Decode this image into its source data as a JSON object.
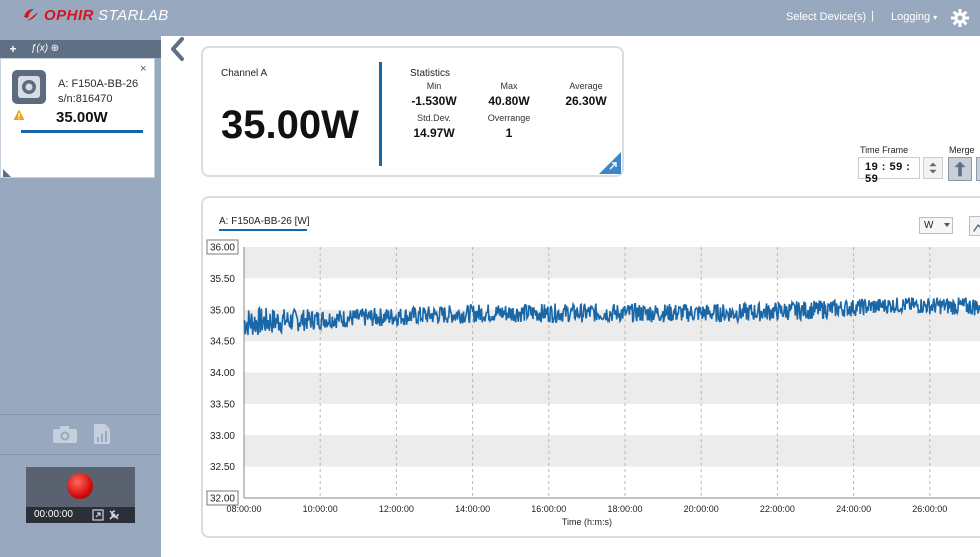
{
  "app": {
    "logo_brand": "OPHIR",
    "logo_product": "STARLAB",
    "select_devices_label": "Select Device(s)",
    "separator": "|",
    "logging_label": "Logging",
    "icons": {
      "gear": "gear-icon",
      "back": "chevron-left-icon"
    }
  },
  "sidebar": {
    "toolbar": {
      "add_label": "+",
      "math_label": "ƒ(x)"
    },
    "device": {
      "name": "A: F150A-BB-26",
      "serial": "s/n:816470",
      "value": "35.00W",
      "close_label": "×",
      "accent_color": "#1a67a8",
      "warning_color": "#e9a21a"
    },
    "recorder": {
      "elapsed": "00:00:00",
      "record_color": "#d40d0d"
    }
  },
  "channel": {
    "title": "Channel A",
    "value": "35.00W",
    "stats_title": "Statistics",
    "min_label": "Min",
    "min_value": "-1.530W",
    "max_label": "Max",
    "max_value": "40.80W",
    "avg_label": "Average",
    "avg_value": "26.30W",
    "std_label": "Std.Dev.",
    "std_value": "14.97W",
    "over_label": "Overrange",
    "over_value": "1"
  },
  "timeframe": {
    "label": "Time Frame",
    "value": "19 : 59 : 59",
    "merge_label": "Merge"
  },
  "graph": {
    "title": "A: F150A-BB-26 [W]",
    "unit": "W"
  },
  "chart_data": {
    "type": "line",
    "series": [
      {
        "color": "#1a67a8",
        "x": [
          "08:00:00",
          "10:00:00",
          "12:00:00",
          "14:00:00",
          "16:00:00",
          "18:00:00",
          "20:00:00",
          "22:00:00",
          "24:00:00",
          "26:00:00"
        ],
        "band_low": [
          34.55,
          34.7,
          34.75,
          34.8,
          34.8,
          34.8,
          34.8,
          34.85,
          34.95,
          34.9
        ],
        "band_high": [
          35.05,
          35.0,
          35.05,
          35.1,
          35.1,
          35.1,
          35.1,
          35.15,
          35.2,
          35.2
        ]
      }
    ],
    "xlabel": "Time (h:m:s)",
    "x_ticks": [
      "08:00:00",
      "10:00:00",
      "12:00:00",
      "14:00:00",
      "16:00:00",
      "18:00:00",
      "20:00:00",
      "22:00:00",
      "24:00:00",
      "26:00:00"
    ],
    "y_ticks": [
      "36.00",
      "35.50",
      "35.00",
      "34.50",
      "34.00",
      "33.50",
      "33.00",
      "32.50",
      "32.00"
    ],
    "ylim": [
      32.0,
      36.0
    ],
    "grid": "horizontal bands, vertical dashed",
    "band_color": "#ececec"
  }
}
